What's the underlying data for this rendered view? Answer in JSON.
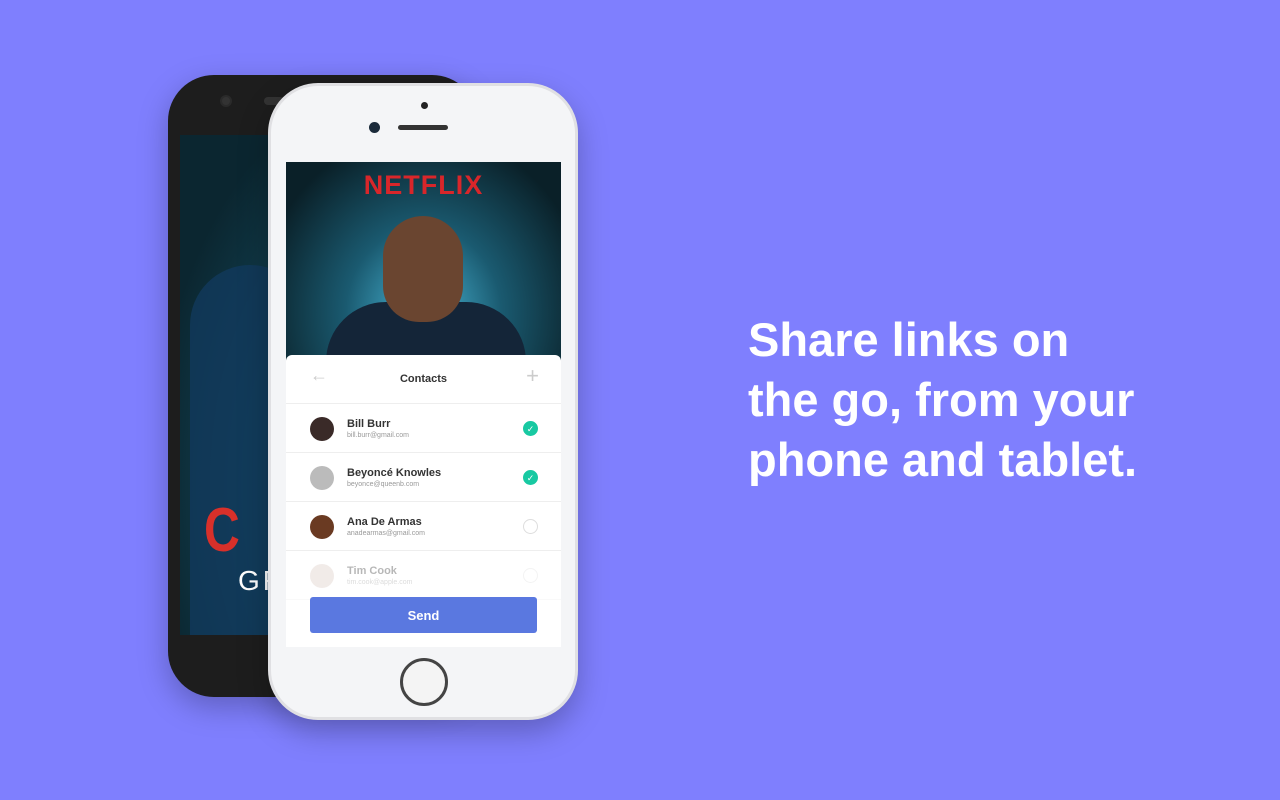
{
  "headline": {
    "line1": "Share links on",
    "line2": "the go, from your",
    "line3": "phone and tablet."
  },
  "back_phone": {
    "poster_title": "C H",
    "poster_subtitle": "GR"
  },
  "front_phone": {
    "brand": "NETFLIX",
    "contacts": {
      "title": "Contacts",
      "back_icon": "←",
      "add_icon": "+",
      "items": [
        {
          "name": "Bill Burr",
          "email": "bill.burr@gmail.com",
          "selected": true,
          "avatar": "#3a2a28"
        },
        {
          "name": "Beyoncé Knowles",
          "email": "beyonce@queenb.com",
          "selected": true,
          "avatar": "#bbbbbb"
        },
        {
          "name": "Ana De Armas",
          "email": "anadearmas@gmail.com",
          "selected": false,
          "avatar": "#6a3a22"
        },
        {
          "name": "Tim Cook",
          "email": "tim.cook@apple.com",
          "selected": false,
          "avatar": "#d8c8c0"
        }
      ],
      "check_glyph": "✓",
      "send_label": "Send"
    }
  },
  "colors": {
    "background": "#7f7ffe",
    "accent": "#5a78e0",
    "check": "#18c9a2",
    "netflix_red": "#d8262a"
  }
}
